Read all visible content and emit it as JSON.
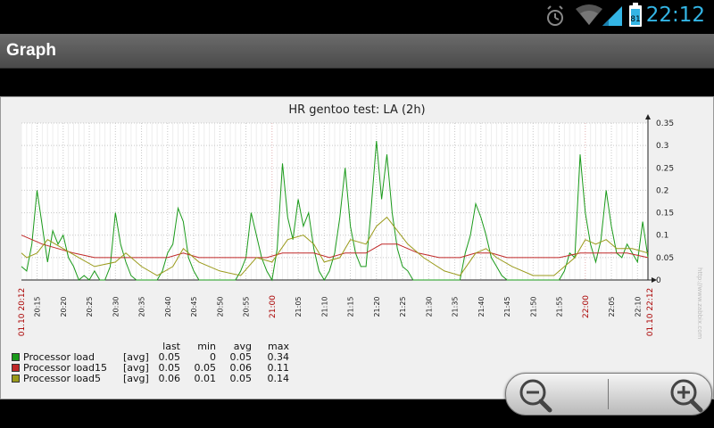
{
  "status_bar": {
    "time": "22:12",
    "battery_level": "81",
    "accent_color": "#33b5e5",
    "icons": [
      "alarm-icon",
      "wifi-icon",
      "signal-icon",
      "battery-icon"
    ]
  },
  "app": {
    "title": "Graph"
  },
  "chart_data": {
    "type": "line",
    "title": "HR gentoo test: LA (2h)",
    "ylim": [
      0,
      0.35
    ],
    "y_ticks": [
      "0",
      "0.05",
      "0.1",
      "0.15",
      "0.2",
      "0.25",
      "0.3",
      "0.35"
    ],
    "x_start": "20:12",
    "x_end": "22:12",
    "start_date_label": "01.10 20:12",
    "end_date_label": "01.10 22:12",
    "x_ticks": [
      {
        "t": "20:15",
        "red": false
      },
      {
        "t": "20:20",
        "red": false
      },
      {
        "t": "20:25",
        "red": false
      },
      {
        "t": "20:30",
        "red": false
      },
      {
        "t": "20:35",
        "red": false
      },
      {
        "t": "20:40",
        "red": false
      },
      {
        "t": "20:45",
        "red": false
      },
      {
        "t": "20:50",
        "red": false
      },
      {
        "t": "20:55",
        "red": false
      },
      {
        "t": "21:00",
        "red": true
      },
      {
        "t": "21:05",
        "red": false
      },
      {
        "t": "21:10",
        "red": false
      },
      {
        "t": "21:15",
        "red": false
      },
      {
        "t": "21:20",
        "red": false
      },
      {
        "t": "21:25",
        "red": false
      },
      {
        "t": "21:30",
        "red": false
      },
      {
        "t": "21:35",
        "red": false
      },
      {
        "t": "21:40",
        "red": false
      },
      {
        "t": "21:45",
        "red": false
      },
      {
        "t": "21:50",
        "red": false
      },
      {
        "t": "21:55",
        "red": false
      },
      {
        "t": "22:00",
        "red": true
      },
      {
        "t": "22:05",
        "red": false
      },
      {
        "t": "22:10",
        "red": false
      }
    ],
    "grid": true,
    "series": [
      {
        "name": "Processor load",
        "color": "#1a9a1a",
        "points": [
          [
            "20:12",
            0.03
          ],
          [
            "20:13",
            0.02
          ],
          [
            "20:14",
            0.08
          ],
          [
            "20:15",
            0.2
          ],
          [
            "20:16",
            0.12
          ],
          [
            "20:17",
            0.04
          ],
          [
            "20:18",
            0.11
          ],
          [
            "20:19",
            0.08
          ],
          [
            "20:20",
            0.1
          ],
          [
            "20:21",
            0.05
          ],
          [
            "20:22",
            0.03
          ],
          [
            "20:23",
            0
          ],
          [
            "20:24",
            0.01
          ],
          [
            "20:25",
            0
          ],
          [
            "20:26",
            0.02
          ],
          [
            "20:27",
            0
          ],
          [
            "20:28",
            0
          ],
          [
            "20:29",
            0.03
          ],
          [
            "20:30",
            0.15
          ],
          [
            "20:31",
            0.08
          ],
          [
            "20:32",
            0.04
          ],
          [
            "20:33",
            0.01
          ],
          [
            "20:34",
            0
          ],
          [
            "20:35",
            0
          ],
          [
            "20:36",
            0
          ],
          [
            "20:37",
            0
          ],
          [
            "20:38",
            0
          ],
          [
            "20:39",
            0.02
          ],
          [
            "20:40",
            0.06
          ],
          [
            "20:41",
            0.08
          ],
          [
            "20:42",
            0.16
          ],
          [
            "20:43",
            0.13
          ],
          [
            "20:44",
            0.05
          ],
          [
            "20:45",
            0.02
          ],
          [
            "20:46",
            0
          ],
          [
            "20:47",
            0
          ],
          [
            "20:48",
            0
          ],
          [
            "20:49",
            0
          ],
          [
            "20:50",
            0
          ],
          [
            "20:51",
            0
          ],
          [
            "20:52",
            0
          ],
          [
            "20:53",
            0
          ],
          [
            "20:54",
            0.02
          ],
          [
            "20:55",
            0.05
          ],
          [
            "20:56",
            0.15
          ],
          [
            "20:57",
            0.1
          ],
          [
            "20:58",
            0.05
          ],
          [
            "20:59",
            0.02
          ],
          [
            "21:00",
            0
          ],
          [
            "21:01",
            0.07
          ],
          [
            "21:02",
            0.26
          ],
          [
            "21:03",
            0.14
          ],
          [
            "21:04",
            0.09
          ],
          [
            "21:05",
            0.18
          ],
          [
            "21:06",
            0.12
          ],
          [
            "21:07",
            0.15
          ],
          [
            "21:08",
            0.07
          ],
          [
            "21:09",
            0.02
          ],
          [
            "21:10",
            0
          ],
          [
            "21:11",
            0.02
          ],
          [
            "21:12",
            0.06
          ],
          [
            "21:13",
            0.14
          ],
          [
            "21:14",
            0.25
          ],
          [
            "21:15",
            0.12
          ],
          [
            "21:16",
            0.06
          ],
          [
            "21:17",
            0.03
          ],
          [
            "21:18",
            0.03
          ],
          [
            "21:19",
            0.16
          ],
          [
            "21:20",
            0.31
          ],
          [
            "21:21",
            0.18
          ],
          [
            "21:22",
            0.28
          ],
          [
            "21:23",
            0.15
          ],
          [
            "21:24",
            0.07
          ],
          [
            "21:25",
            0.03
          ],
          [
            "21:26",
            0.02
          ],
          [
            "21:27",
            0
          ],
          [
            "21:28",
            0
          ],
          [
            "21:29",
            0
          ],
          [
            "21:30",
            0
          ],
          [
            "21:31",
            0
          ],
          [
            "21:32",
            0
          ],
          [
            "21:33",
            0
          ],
          [
            "21:34",
            0
          ],
          [
            "21:35",
            0
          ],
          [
            "21:36",
            0
          ],
          [
            "21:37",
            0.06
          ],
          [
            "21:38",
            0.1
          ],
          [
            "21:39",
            0.17
          ],
          [
            "21:40",
            0.14
          ],
          [
            "21:41",
            0.1
          ],
          [
            "21:42",
            0.05
          ],
          [
            "21:43",
            0.03
          ],
          [
            "21:44",
            0.01
          ],
          [
            "21:45",
            0
          ],
          [
            "21:46",
            0
          ],
          [
            "21:47",
            0
          ],
          [
            "21:48",
            0
          ],
          [
            "21:49",
            0
          ],
          [
            "21:50",
            0
          ],
          [
            "21:51",
            0
          ],
          [
            "21:52",
            0
          ],
          [
            "21:53",
            0
          ],
          [
            "21:54",
            0
          ],
          [
            "21:55",
            0
          ],
          [
            "21:56",
            0.02
          ],
          [
            "21:57",
            0.06
          ],
          [
            "21:58",
            0.05
          ],
          [
            "21:59",
            0.28
          ],
          [
            "22:00",
            0.15
          ],
          [
            "22:01",
            0.08
          ],
          [
            "22:02",
            0.04
          ],
          [
            "22:03",
            0.09
          ],
          [
            "22:04",
            0.2
          ],
          [
            "22:05",
            0.12
          ],
          [
            "22:06",
            0.06
          ],
          [
            "22:07",
            0.05
          ],
          [
            "22:08",
            0.08
          ],
          [
            "22:09",
            0.06
          ],
          [
            "22:10",
            0.04
          ],
          [
            "22:11",
            0.13
          ],
          [
            "22:12",
            0.05
          ]
        ]
      },
      {
        "name": "Processor load15",
        "color": "#c02828",
        "points": [
          [
            "20:12",
            0.1
          ],
          [
            "20:14",
            0.09
          ],
          [
            "20:16",
            0.08
          ],
          [
            "20:19",
            0.07
          ],
          [
            "20:22",
            0.06
          ],
          [
            "20:26",
            0.05
          ],
          [
            "20:30",
            0.05
          ],
          [
            "20:35",
            0.05
          ],
          [
            "20:40",
            0.05
          ],
          [
            "20:43",
            0.06
          ],
          [
            "20:46",
            0.05
          ],
          [
            "20:50",
            0.05
          ],
          [
            "20:55",
            0.05
          ],
          [
            "20:59",
            0.05
          ],
          [
            "21:02",
            0.06
          ],
          [
            "21:05",
            0.06
          ],
          [
            "21:08",
            0.06
          ],
          [
            "21:11",
            0.05
          ],
          [
            "21:14",
            0.06
          ],
          [
            "21:18",
            0.06
          ],
          [
            "21:21",
            0.08
          ],
          [
            "21:24",
            0.08
          ],
          [
            "21:26",
            0.07
          ],
          [
            "21:28",
            0.06
          ],
          [
            "21:32",
            0.05
          ],
          [
            "21:36",
            0.05
          ],
          [
            "21:39",
            0.06
          ],
          [
            "21:42",
            0.06
          ],
          [
            "21:45",
            0.05
          ],
          [
            "21:50",
            0.05
          ],
          [
            "21:55",
            0.05
          ],
          [
            "21:59",
            0.06
          ],
          [
            "22:02",
            0.06
          ],
          [
            "22:05",
            0.06
          ],
          [
            "22:08",
            0.06
          ],
          [
            "22:12",
            0.05
          ]
        ]
      },
      {
        "name": "Processor load5",
        "color": "#9a9a1a",
        "points": [
          [
            "20:12",
            0.06
          ],
          [
            "20:13",
            0.05
          ],
          [
            "20:15",
            0.06
          ],
          [
            "20:17",
            0.09
          ],
          [
            "20:20",
            0.07
          ],
          [
            "20:23",
            0.05
          ],
          [
            "20:26",
            0.03
          ],
          [
            "20:30",
            0.04
          ],
          [
            "20:32",
            0.06
          ],
          [
            "20:35",
            0.03
          ],
          [
            "20:38",
            0.01
          ],
          [
            "20:41",
            0.03
          ],
          [
            "20:43",
            0.07
          ],
          [
            "20:46",
            0.04
          ],
          [
            "20:50",
            0.02
          ],
          [
            "20:54",
            0.01
          ],
          [
            "20:57",
            0.05
          ],
          [
            "21:00",
            0.04
          ],
          [
            "21:03",
            0.09
          ],
          [
            "21:06",
            0.1
          ],
          [
            "21:08",
            0.08
          ],
          [
            "21:10",
            0.04
          ],
          [
            "21:13",
            0.05
          ],
          [
            "21:15",
            0.09
          ],
          [
            "21:18",
            0.08
          ],
          [
            "21:20",
            0.12
          ],
          [
            "21:22",
            0.14
          ],
          [
            "21:24",
            0.11
          ],
          [
            "21:26",
            0.08
          ],
          [
            "21:29",
            0.05
          ],
          [
            "21:33",
            0.02
          ],
          [
            "21:36",
            0.01
          ],
          [
            "21:39",
            0.06
          ],
          [
            "21:41",
            0.07
          ],
          [
            "21:43",
            0.05
          ],
          [
            "21:46",
            0.03
          ],
          [
            "21:50",
            0.01
          ],
          [
            "21:54",
            0.01
          ],
          [
            "21:58",
            0.05
          ],
          [
            "22:00",
            0.09
          ],
          [
            "22:02",
            0.08
          ],
          [
            "22:04",
            0.09
          ],
          [
            "22:06",
            0.07
          ],
          [
            "22:09",
            0.07
          ],
          [
            "22:12",
            0.06
          ]
        ]
      }
    ]
  },
  "legend": {
    "headers": {
      "last": "last",
      "min": "min",
      "avg": "avg",
      "max": "max"
    },
    "rows": [
      {
        "name": "Processor load",
        "func": "[avg]",
        "last": "0.05",
        "min": "0",
        "avg": "0.05",
        "max": "0.34",
        "color": "#1a9a1a"
      },
      {
        "name": "Processor load15",
        "func": "[avg]",
        "last": "0.05",
        "min": "0.05",
        "avg": "0.06",
        "max": "0.11",
        "color": "#c02828"
      },
      {
        "name": "Processor load5",
        "func": "[avg]",
        "last": "0.06",
        "min": "0.01",
        "avg": "0.05",
        "max": "0.14",
        "color": "#9a9a1a"
      }
    ]
  },
  "watermark": "http://www.zabbix.com",
  "zoom": {
    "out_icon": "zoom-out-icon",
    "in_icon": "zoom-in-icon"
  }
}
